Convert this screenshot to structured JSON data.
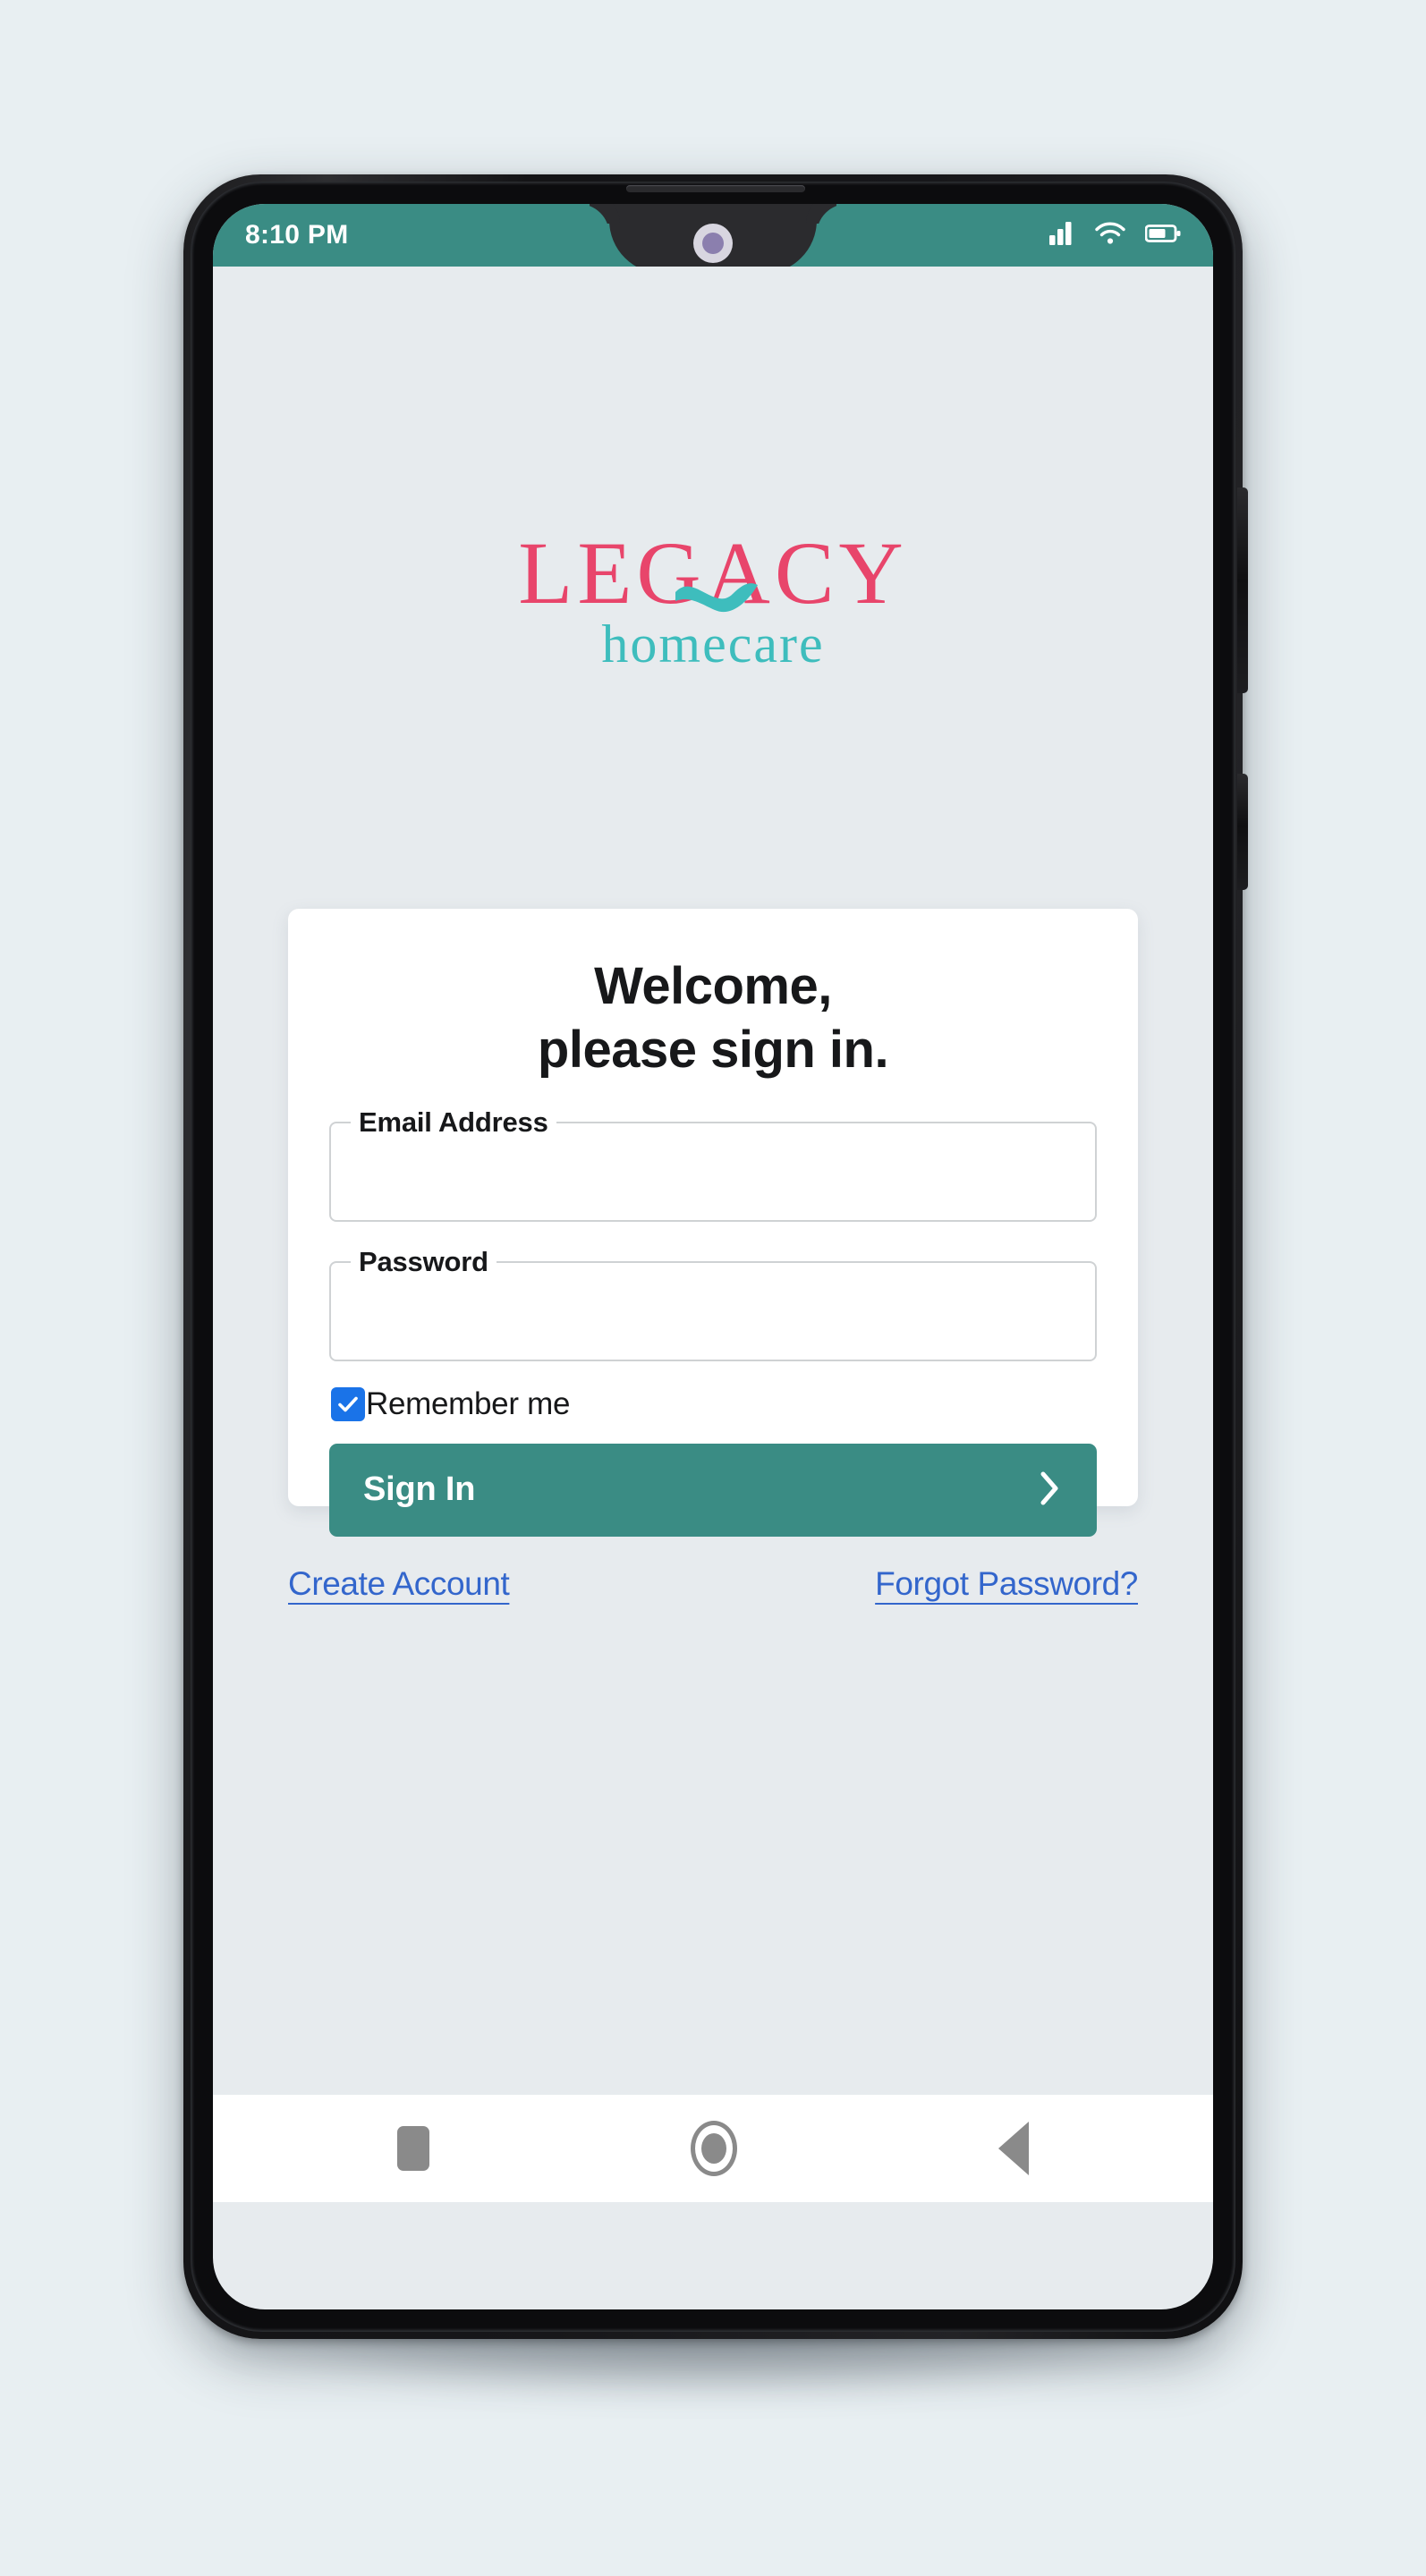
{
  "device": {
    "status_bar": {
      "time": "8:10 PM",
      "icons": [
        "signal-icon",
        "wifi-icon",
        "battery-icon"
      ],
      "background_color": "#3A8C84",
      "battery_level_percent": 60
    },
    "nav_bar": {
      "items": [
        "recents-button",
        "home-button",
        "back-button"
      ]
    }
  },
  "app": {
    "background_color": "#E7EBEE",
    "logo": {
      "primary_text": "LEGACY",
      "secondary_text": "homecare",
      "primary_color": "#E8456B",
      "secondary_color": "#3EBDBD",
      "accent_shape": "wave-swoosh"
    },
    "card": {
      "heading_line1": "Welcome,",
      "heading_line2": "please sign in.",
      "fields": [
        {
          "name": "email",
          "label": "Email Address",
          "value": "",
          "placeholder": ""
        },
        {
          "name": "password",
          "label": "Password",
          "value": "",
          "placeholder": ""
        }
      ],
      "remember_me": {
        "label": "Remember me",
        "checked": true,
        "checkbox_color": "#1A73E8"
      },
      "submit": {
        "label": "Sign In",
        "icon": "chevron-right-icon",
        "background_color": "#3A8C84"
      }
    },
    "links": {
      "create_account": "Create Account",
      "forgot_password": "Forgot Password?",
      "color": "#3366CC"
    }
  }
}
